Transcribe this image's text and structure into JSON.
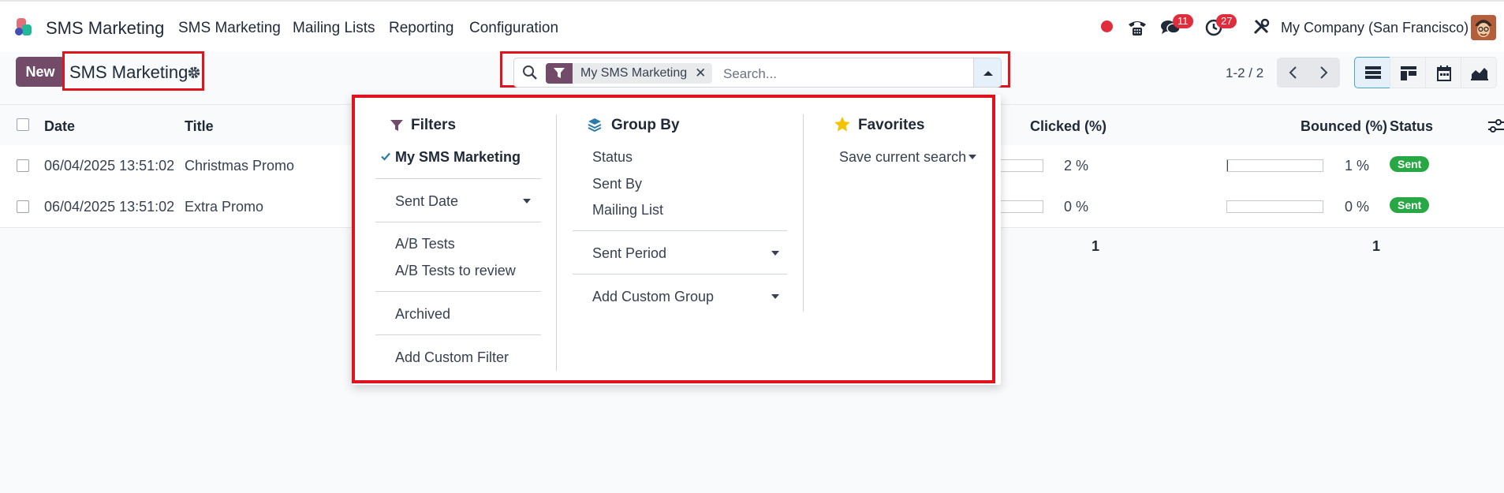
{
  "navbar": {
    "app_name": "SMS Marketing",
    "menus": [
      "SMS Marketing",
      "Mailing Lists",
      "Reporting",
      "Configuration"
    ],
    "messages_badge": "11",
    "activities_badge": "27",
    "company": "My Company (San Francisco)"
  },
  "control": {
    "new_label": "New",
    "title": "SMS Marketing",
    "facet_label": "My SMS Marketing",
    "search_placeholder": "Search...",
    "pager": "1-2 / 2"
  },
  "table": {
    "columns": [
      "Date",
      "Title",
      "Clicked (%)",
      "Bounced (%)",
      "Status"
    ],
    "rows": [
      {
        "date": "06/04/2025 13:51:02",
        "title": "Christmas Promo",
        "clicked": "2 %",
        "clicked_value": 2,
        "bounced": "1 %",
        "bounced_value": 1,
        "status": "Sent"
      },
      {
        "date": "06/04/2025 13:51:02",
        "title": "Extra Promo",
        "clicked": "0 %",
        "clicked_value": 0,
        "bounced": "0 %",
        "bounced_value": 0,
        "status": "Sent"
      }
    ],
    "totals": {
      "clicked": "1",
      "bounced": "1"
    }
  },
  "dropdown": {
    "filters": {
      "heading": "Filters",
      "items": [
        "My SMS Marketing",
        "Sent Date",
        "A/B Tests",
        "A/B Tests to review",
        "Archived",
        "Add Custom Filter"
      ]
    },
    "group_by": {
      "heading": "Group By",
      "items": [
        "Status",
        "Sent By",
        "Mailing List",
        "Sent Period",
        "Add Custom Group"
      ]
    },
    "favorites": {
      "heading": "Favorites",
      "items": [
        "Save current search"
      ]
    }
  },
  "colors": {
    "brand": "#714b67",
    "accent_red": "#e02d3c",
    "status_green": "#28a745",
    "highlight": "#e0141e"
  }
}
